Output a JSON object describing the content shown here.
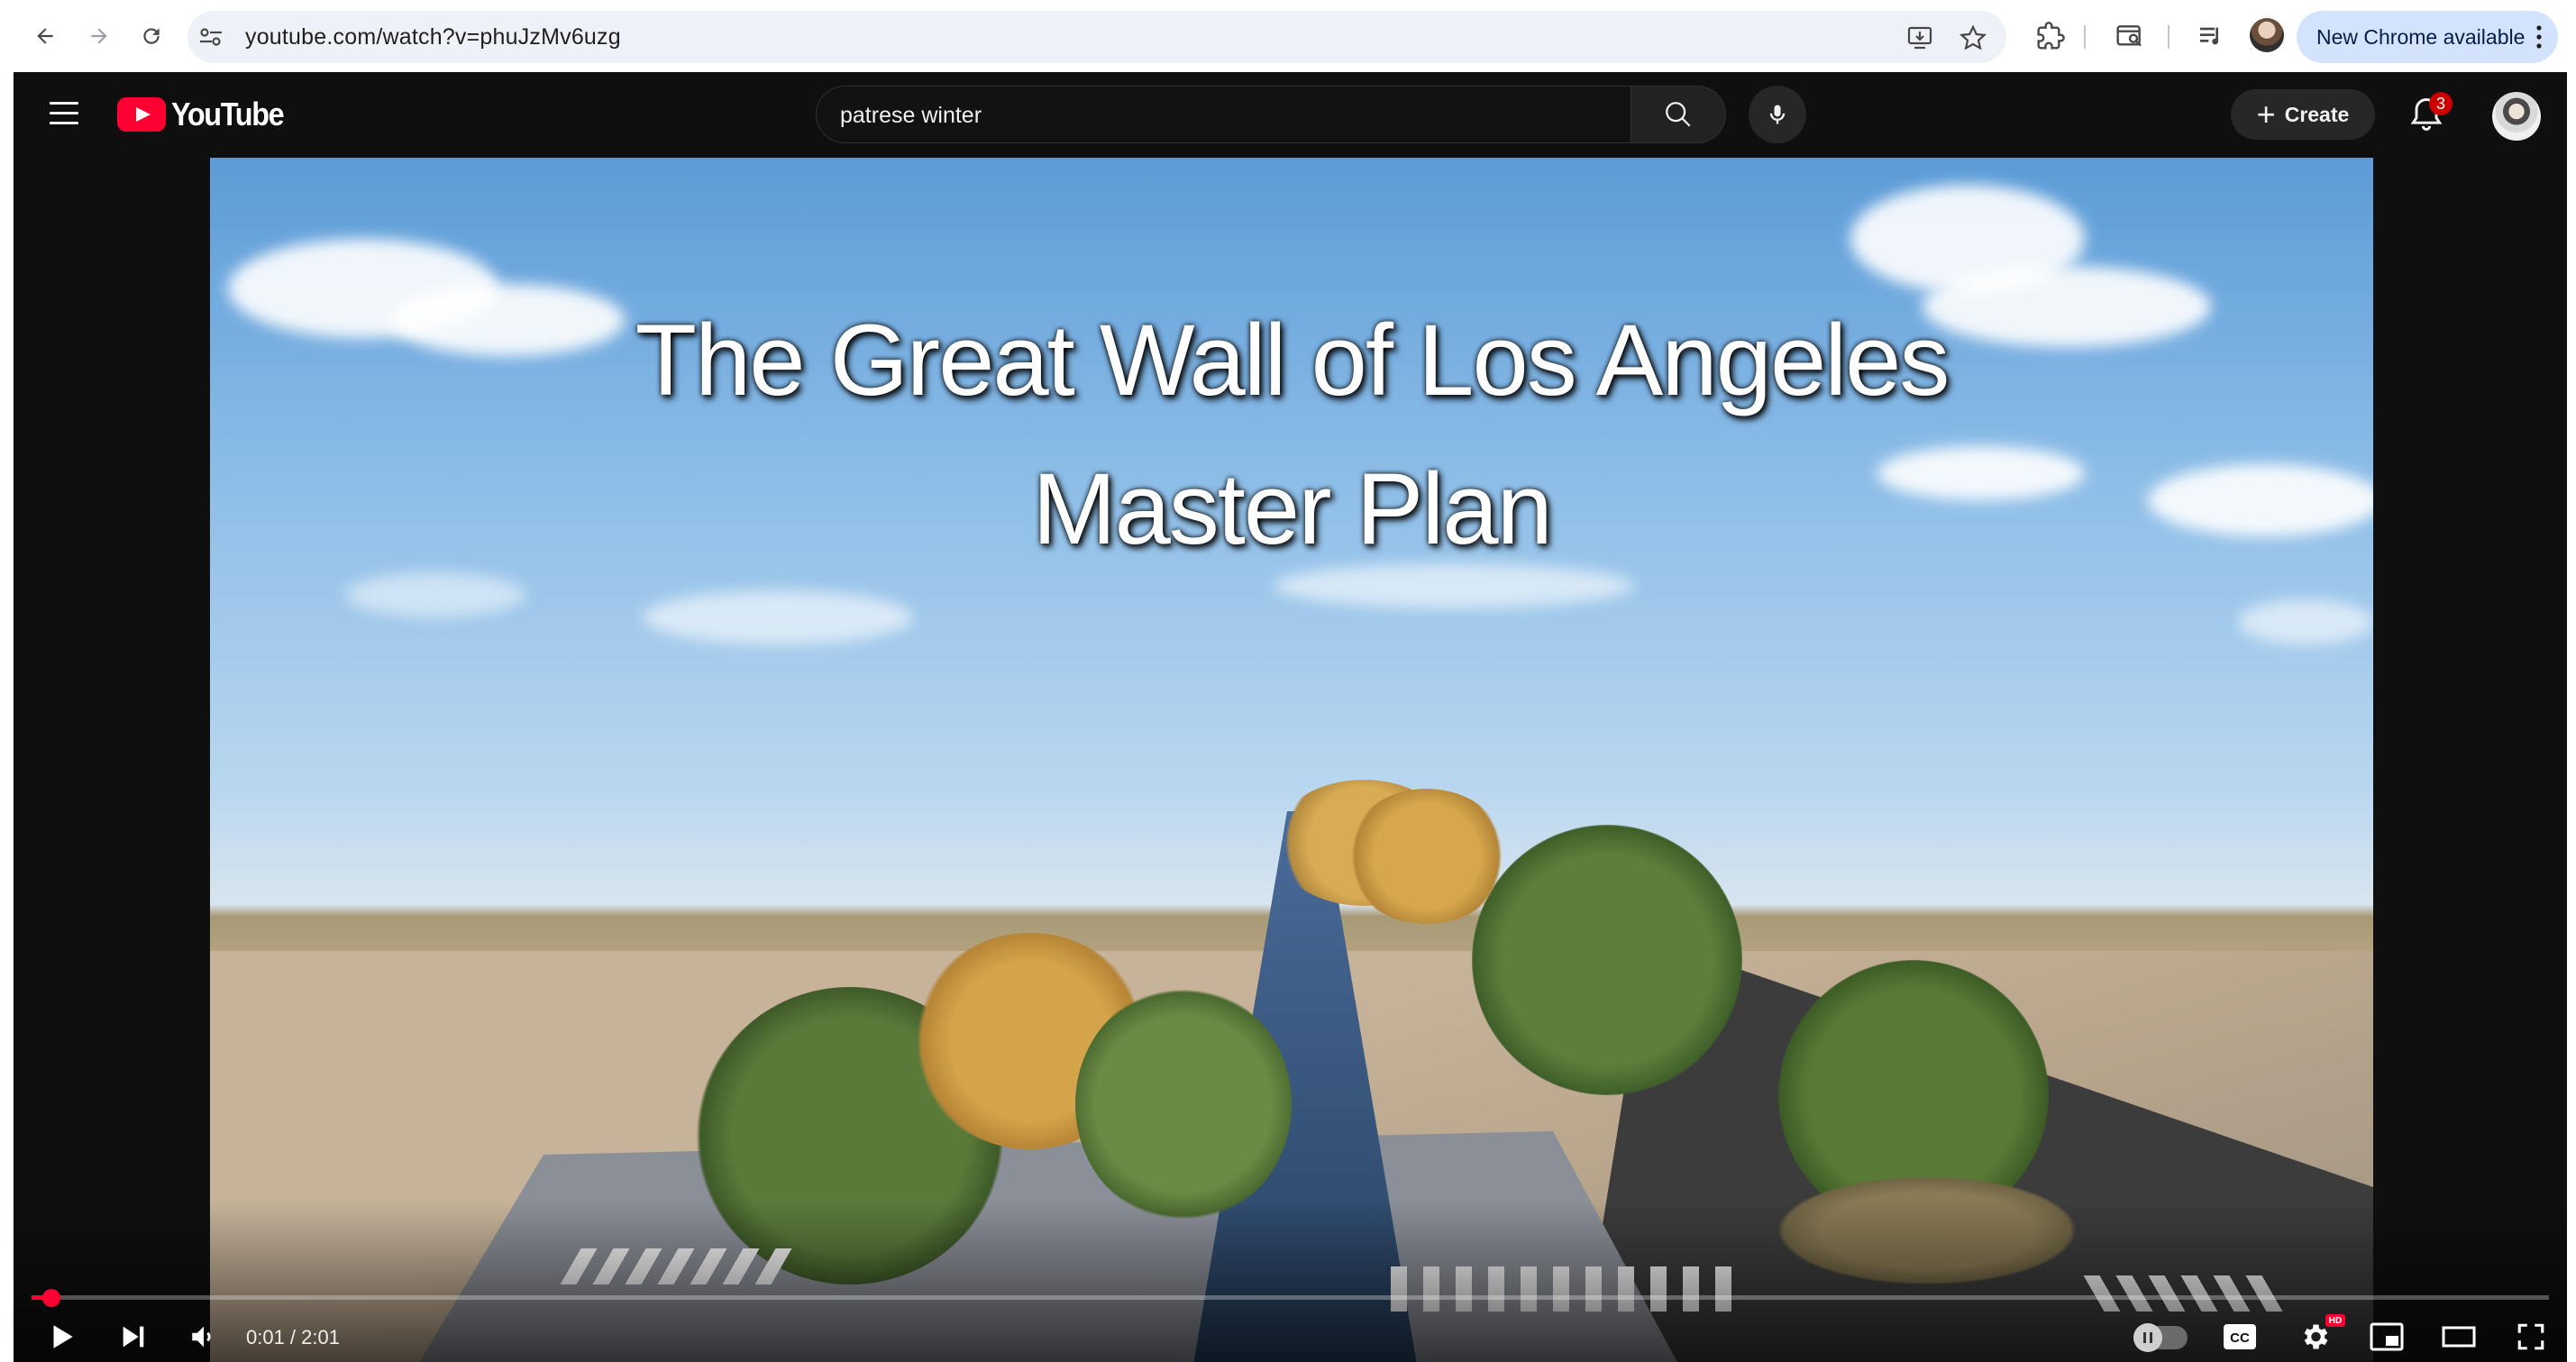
{
  "browser": {
    "url": "youtube.com/watch?v=phuJzMv6uzg",
    "update_button": "New Chrome available",
    "icons": [
      "back-icon",
      "forward-icon",
      "reload-icon",
      "site-info-icon",
      "install-app-icon",
      "bookmark-star-icon",
      "extensions-icon",
      "tab-search-icon",
      "media-controls-icon",
      "profile-avatar",
      "kebab-menu-icon"
    ]
  },
  "masthead": {
    "logo_text": "YouTube",
    "search_value": "patrese winter",
    "create_label": "Create",
    "notification_count": "3"
  },
  "player": {
    "title_line_1": "The Great Wall of Los Angeles",
    "title_line_2": "Master Plan",
    "time_display": "0:01 / 2:01",
    "progress_fraction": 0.008,
    "controls": [
      "play",
      "next",
      "volume",
      "autoplay",
      "subtitles",
      "settings",
      "miniplayer",
      "theater",
      "fullscreen"
    ]
  },
  "colors": {
    "youtube_red": "#ff0033",
    "masthead_bg": "#0f0f0f",
    "update_pill": "#d3e3fd"
  }
}
